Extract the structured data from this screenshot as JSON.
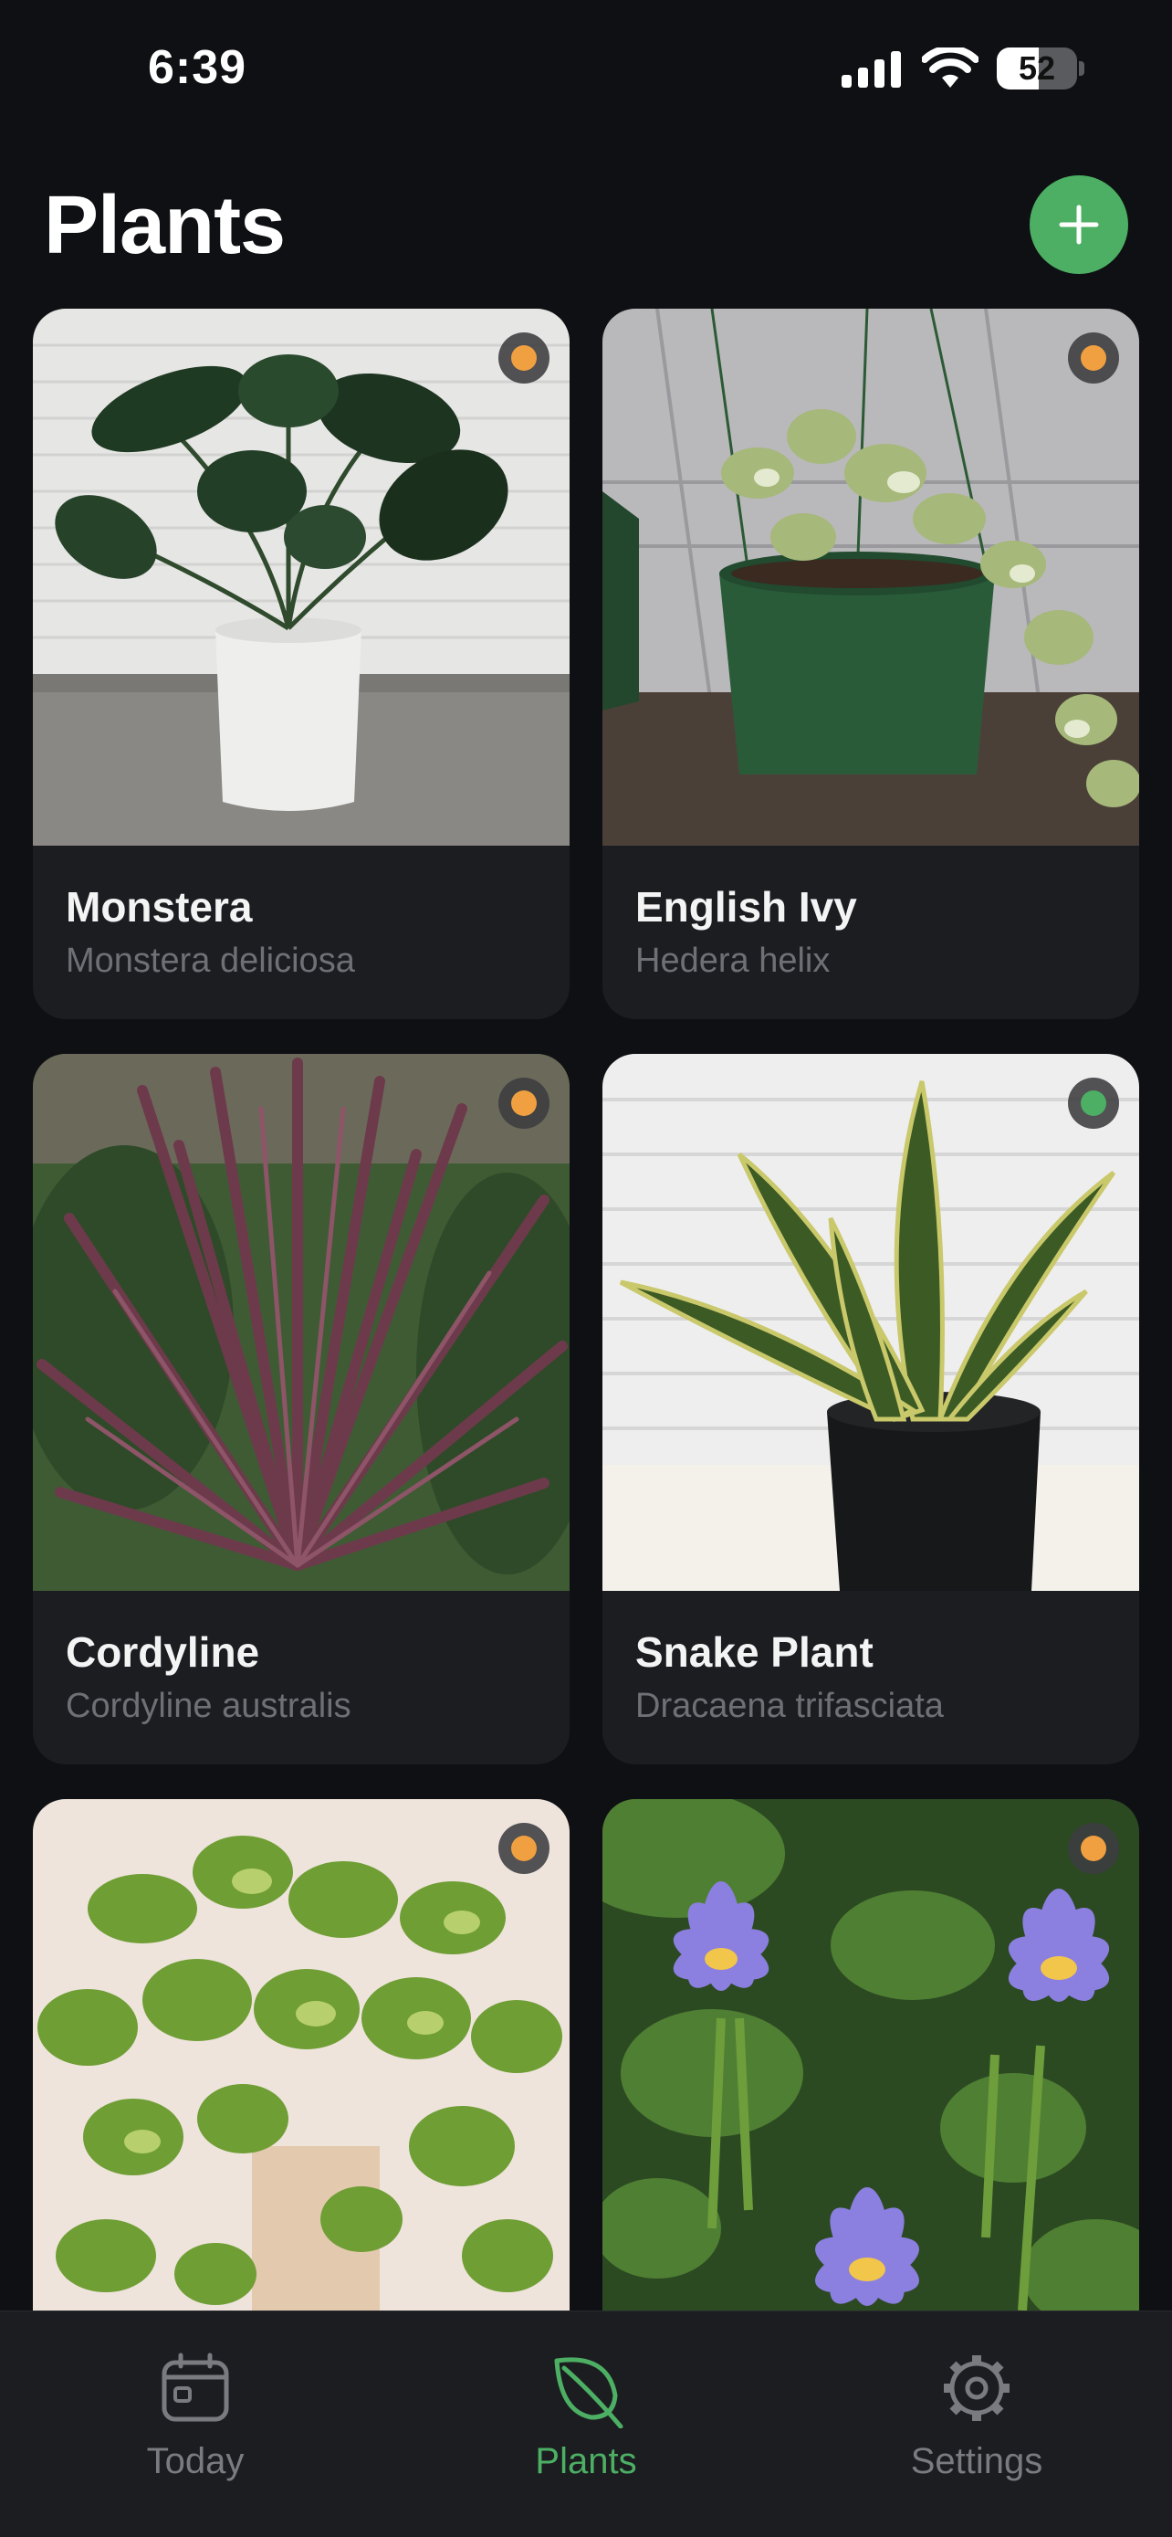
{
  "status_bar": {
    "time": "6:39",
    "battery_level": 52,
    "battery_text": "52"
  },
  "header": {
    "title": "Plants",
    "add_button_icon": "plus-icon"
  },
  "colors": {
    "accent": "#4caf63",
    "background": "#0f1013",
    "card": "#1c1d21",
    "status_orange": "#f0a040",
    "status_green": "#4caf63",
    "tab_inactive": "#7a7b80"
  },
  "plants": [
    {
      "name": "Monstera",
      "scientific_name": "Monstera deliciosa",
      "status_color": "#f0a040"
    },
    {
      "name": "English Ivy",
      "scientific_name": "Hedera helix",
      "status_color": "#f0a040"
    },
    {
      "name": "Cordyline",
      "scientific_name": "Cordyline australis",
      "status_color": "#f0a040"
    },
    {
      "name": "Snake Plant",
      "scientific_name": "Dracaena trifasciata",
      "status_color": "#4caf63"
    },
    {
      "name": "",
      "scientific_name": "",
      "status_color": "#f0a040"
    },
    {
      "name": "",
      "scientific_name": "",
      "status_color": "#f0a040"
    }
  ],
  "tab_bar": {
    "tabs": [
      {
        "label": "Today",
        "icon": "calendar-icon",
        "active": false
      },
      {
        "label": "Plants",
        "icon": "leaf-icon",
        "active": true
      },
      {
        "label": "Settings",
        "icon": "gear-icon",
        "active": false
      }
    ]
  }
}
